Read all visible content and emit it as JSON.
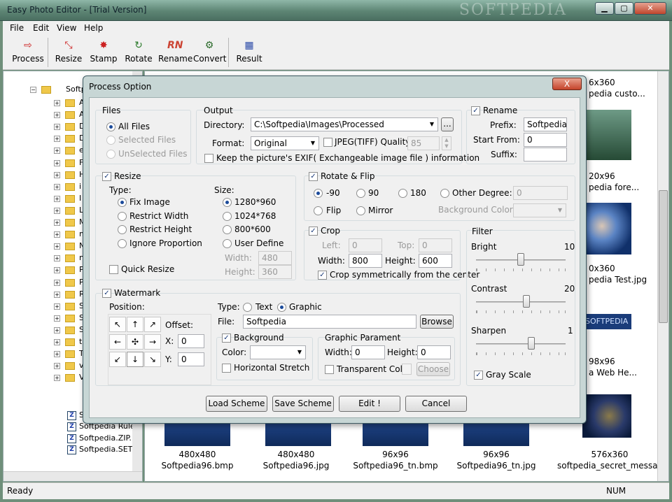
{
  "window": {
    "title": "Easy Photo Editor - [Trial Version]",
    "watermark": "SOFTPEDIA"
  },
  "menu": [
    "File",
    "Edit",
    "View",
    "Help"
  ],
  "toolbar": [
    {
      "label": "Process",
      "icon": "process-icon"
    },
    {
      "label": "Resize",
      "icon": "resize-icon"
    },
    {
      "label": "Stamp",
      "icon": "stamp-icon"
    },
    {
      "label": "Rotate",
      "icon": "rotate-icon"
    },
    {
      "label": "Rename",
      "icon": "rename-icon"
    },
    {
      "label": "Convert",
      "icon": "convert-icon"
    },
    {
      "label": "Result",
      "icon": "result-icon"
    }
  ],
  "tree": {
    "root": "Softp",
    "letters": [
      "A",
      "A",
      "D",
      "D",
      "e",
      "F",
      "H",
      "i",
      "I",
      "L",
      "M",
      "m",
      "N",
      "n",
      "P",
      "P",
      "R",
      "S",
      "S",
      "S",
      "t",
      "T",
      "v",
      "V"
    ],
    "files": [
      "Softpedia.ENC",
      "Softpedia Rule",
      "Softpedia.ZIP.",
      "Softpedia.SET"
    ]
  },
  "thumbs": {
    "right_captions": [
      "6x360",
      "pedia custo...",
      "20x96",
      "pedia fore...",
      "0x360",
      "pedia Test.jpg",
      "98x96",
      "a Web He...",
      "SOFTPEDIA"
    ],
    "bottom": [
      {
        "size": "480x480",
        "name": "Softpedia96.bmp"
      },
      {
        "size": "480x480",
        "name": "Softpedia96.jpg"
      },
      {
        "size": "96x96",
        "name": "Softpedia96_tn.bmp"
      },
      {
        "size": "96x96",
        "name": "Softpedia96_tn.jpg"
      },
      {
        "size": "576x360",
        "name": "softpedia_secret_messa..."
      }
    ]
  },
  "status": {
    "left": "Ready",
    "right": "NUM"
  },
  "dialog": {
    "title": "Process Option",
    "close": "X",
    "files": {
      "title": "Files",
      "options": [
        "All Files",
        "Selected Files",
        "UnSelected Files"
      ]
    },
    "output": {
      "title": "Output",
      "directory_label": "Directory:",
      "directory": "C:\\Softpedia\\Images\\Processed",
      "browse": "...",
      "format_label": "Format:",
      "format": "Original",
      "jpeg_label": "JPEG(TIFF) Quality:",
      "jpeg_value": "85",
      "exif": "Keep the picture's EXIF( Exchangeable image file ) information"
    },
    "rename": {
      "title": "Rename",
      "prefix_label": "Prefix:",
      "prefix": "Softpedia",
      "start_label": "Start From:",
      "start": "0",
      "suffix_label": "Suffix:",
      "suffix": ""
    },
    "resize": {
      "title": "Resize",
      "type_label": "Type:",
      "types": [
        "Fix Image",
        "Restrict Width",
        "Restrict Height",
        "Ignore Proportion"
      ],
      "size_label": "Size:",
      "sizes": [
        "1280*960",
        "1024*768",
        "800*600",
        "User Define"
      ],
      "width_label": "Width:",
      "width": "480",
      "height_label": "Height:",
      "height": "360",
      "quick": "Quick Resize"
    },
    "rotate": {
      "title": "Rotate & Flip",
      "options": [
        "-90",
        "90",
        "180",
        "Other Degree:"
      ],
      "other_value": "0",
      "flip": "Flip",
      "mirror": "Mirror",
      "bg_label": "Background Color:"
    },
    "crop": {
      "title": "Crop",
      "left_label": "Left:",
      "left": "0",
      "top_label": "Top:",
      "top": "0",
      "width_label": "Width:",
      "width": "800",
      "height_label": "Height:",
      "height": "600",
      "symmetric": "Crop symmetrically from the center"
    },
    "filter": {
      "title": "Filter",
      "bright_label": "Bright",
      "bright": "10",
      "bright_level": 0.5,
      "contrast_label": "Contrast",
      "contrast": "20",
      "contrast_level": 0.56,
      "sharpen_label": "Sharpen",
      "sharpen": "1",
      "sharpen_level": 0.62,
      "gray": "Gray Scale"
    },
    "watermark": {
      "title": "Watermark",
      "position_label": "Position:",
      "offset_label": "Offset:",
      "x_label": "X:",
      "x": "0",
      "y_label": "Y:",
      "y": "0",
      "type_label": "Type:",
      "text": "Text",
      "graphic": "Graphic",
      "file_label": "File:",
      "file": "Softpedia",
      "browse": "Browse",
      "background": "Background",
      "color_label": "Color:",
      "hstretch": "Horizontal Stretch",
      "param_title": "Graphic Parament",
      "pwidth_label": "Width:",
      "pwidth": "0",
      "pheight_label": "Height:",
      "pheight": "0",
      "transparent": "Transparent Color",
      "choose": "Choose",
      "arrows": [
        "↖",
        "↑",
        "↗",
        "←",
        "✣",
        "→",
        "↙",
        "↓",
        "↘"
      ]
    },
    "buttons": [
      "Load Scheme",
      "Save Scheme",
      "Edit !",
      "Cancel"
    ]
  }
}
